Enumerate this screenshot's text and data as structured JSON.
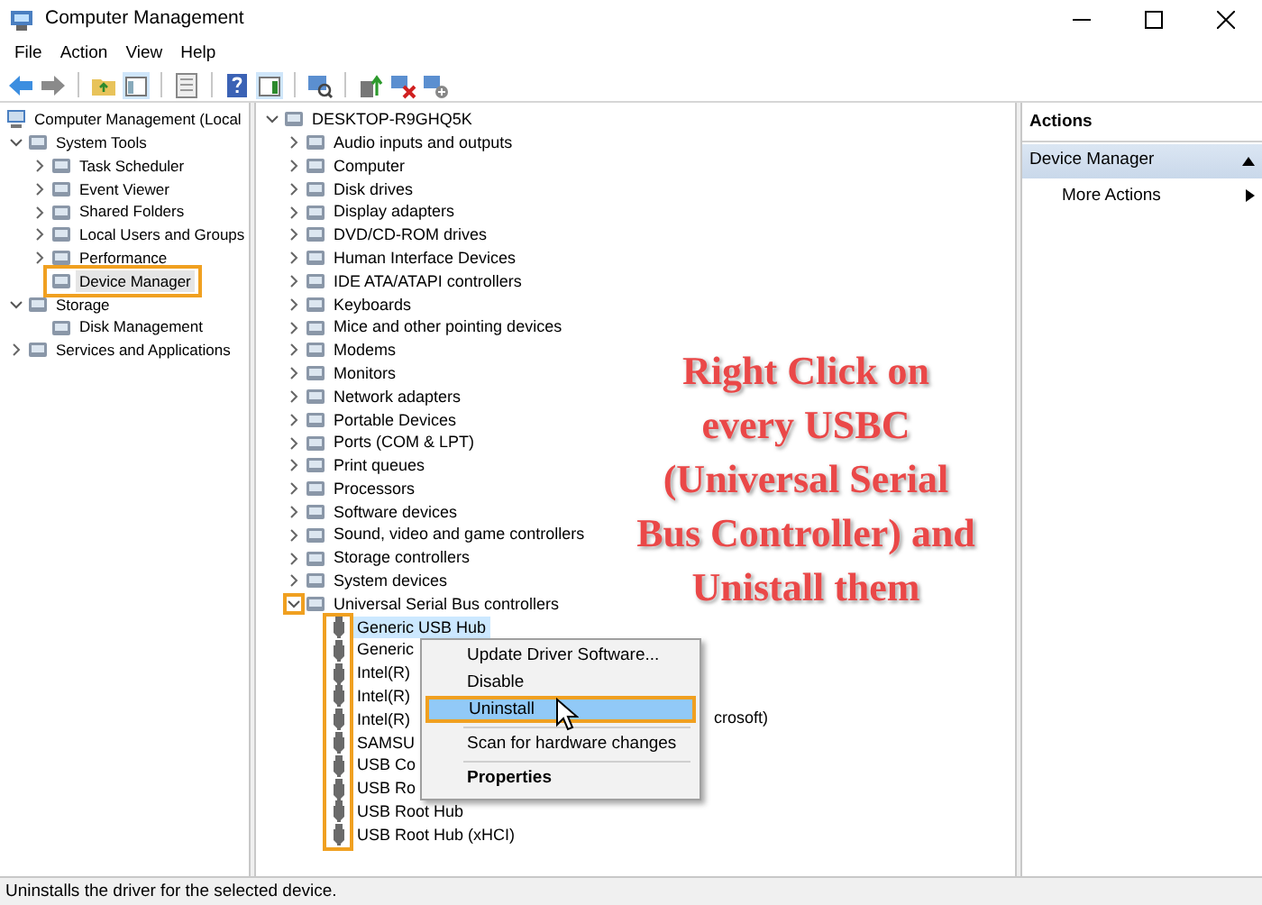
{
  "window": {
    "title": "Computer Management"
  },
  "menu": [
    "File",
    "Action",
    "View",
    "Help"
  ],
  "console_tree": {
    "label": "Computer Management (Local",
    "kind": "root",
    "selected": false,
    "children": [
      {
        "label": "System Tools",
        "kind": "node",
        "expanded": true,
        "selected": false,
        "children": [
          {
            "label": "Task Scheduler",
            "kind": "node",
            "expanded": false,
            "selected": false
          },
          {
            "label": "Event Viewer",
            "kind": "node",
            "expanded": false,
            "selected": false
          },
          {
            "label": "Shared Folders",
            "kind": "node",
            "expanded": false,
            "selected": false
          },
          {
            "label": "Local Users and Groups",
            "kind": "node",
            "expanded": false,
            "selected": false
          },
          {
            "label": "Performance",
            "kind": "node",
            "expanded": false,
            "selected": false
          },
          {
            "label": "Device Manager",
            "kind": "leaf",
            "selected": true,
            "outlined": true
          }
        ]
      },
      {
        "label": "Storage",
        "kind": "node",
        "expanded": true,
        "selected": false,
        "children": [
          {
            "label": "Disk Management",
            "kind": "leaf",
            "selected": false
          }
        ]
      },
      {
        "label": "Services and Applications",
        "kind": "node",
        "expanded": false,
        "selected": false
      }
    ]
  },
  "device_tree": {
    "label": "DESKTOP-R9GHQ5K",
    "kind": "node",
    "expanded": true,
    "selected": false,
    "children": [
      {
        "label": "Audio inputs and outputs",
        "kind": "node",
        "expanded": false,
        "selected": false
      },
      {
        "label": "Computer",
        "kind": "node",
        "expanded": false,
        "selected": false
      },
      {
        "label": "Disk drives",
        "kind": "node",
        "expanded": false,
        "selected": false
      },
      {
        "label": "Display adapters",
        "kind": "node",
        "expanded": false,
        "selected": false
      },
      {
        "label": "DVD/CD-ROM drives",
        "kind": "node",
        "expanded": false,
        "selected": false
      },
      {
        "label": "Human Interface Devices",
        "kind": "node",
        "expanded": false,
        "selected": false
      },
      {
        "label": "IDE ATA/ATAPI controllers",
        "kind": "node",
        "expanded": false,
        "selected": false
      },
      {
        "label": "Keyboards",
        "kind": "node",
        "expanded": false,
        "selected": false
      },
      {
        "label": "Mice and other pointing devices",
        "kind": "node",
        "expanded": false,
        "selected": false
      },
      {
        "label": "Modems",
        "kind": "node",
        "expanded": false,
        "selected": false
      },
      {
        "label": "Monitors",
        "kind": "node",
        "expanded": false,
        "selected": false
      },
      {
        "label": "Network adapters",
        "kind": "node",
        "expanded": false,
        "selected": false
      },
      {
        "label": "Portable Devices",
        "kind": "node",
        "expanded": false,
        "selected": false
      },
      {
        "label": "Ports (COM & LPT)",
        "kind": "node",
        "expanded": false,
        "selected": false
      },
      {
        "label": "Print queues",
        "kind": "node",
        "expanded": false,
        "selected": false
      },
      {
        "label": "Processors",
        "kind": "node",
        "expanded": false,
        "selected": false
      },
      {
        "label": "Software devices",
        "kind": "node",
        "expanded": false,
        "selected": false
      },
      {
        "label": "Sound, video and game controllers",
        "kind": "node",
        "expanded": false,
        "selected": false
      },
      {
        "label": "Storage controllers",
        "kind": "node",
        "expanded": false,
        "selected": false
      },
      {
        "label": "System devices",
        "kind": "node",
        "expanded": false,
        "selected": false
      },
      {
        "label": "Universal Serial Bus controllers",
        "kind": "node",
        "expanded": true,
        "selected": false,
        "chevron_outlined": true,
        "child_icons_outlined": true,
        "children": [
          {
            "label": "Generic USB Hub",
            "kind": "usb",
            "selected": true
          },
          {
            "label": "Generic",
            "kind": "usb",
            "selected": false
          },
          {
            "label": "Intel(R)",
            "kind": "usb",
            "selected": false
          },
          {
            "label": "Intel(R)",
            "kind": "usb",
            "selected": false
          },
          {
            "label": "Intel(R)",
            "kind": "usb",
            "selected": false,
            "tail": "crosoft)"
          },
          {
            "label": "SAMSU",
            "kind": "usb",
            "selected": false
          },
          {
            "label": "USB Co",
            "kind": "usb",
            "selected": false
          },
          {
            "label": "USB Ro",
            "kind": "usb",
            "selected": false
          },
          {
            "label": "USB Root Hub",
            "kind": "usb",
            "selected": false
          },
          {
            "label": "USB Root Hub (xHCI)",
            "kind": "usb",
            "selected": false
          }
        ]
      }
    ]
  },
  "context_menu": {
    "items": [
      {
        "label": "Update Driver Software...",
        "selected": false,
        "default": false,
        "separator_before": false,
        "outlined": false
      },
      {
        "label": "Disable",
        "selected": false,
        "default": false,
        "separator_before": false,
        "outlined": false
      },
      {
        "label": "Uninstall",
        "selected": true,
        "default": false,
        "separator_before": false,
        "outlined": true
      },
      {
        "label": "Scan for hardware changes",
        "selected": false,
        "default": false,
        "separator_before": true,
        "outlined": false
      },
      {
        "label": "Properties",
        "selected": false,
        "default": true,
        "separator_before": true,
        "outlined": false
      }
    ]
  },
  "annotation": {
    "text": "Right Click on\nevery USBC\n(Universal Serial\nBus Controller) and\nUnistall them"
  },
  "actions": {
    "title": "Actions",
    "sections": [
      {
        "title": "Device Manager",
        "expanded": true,
        "items": [
          {
            "label": "More Actions",
            "submenu": true
          }
        ]
      }
    ]
  },
  "status_bar": "Uninstalls the driver for the selected device."
}
